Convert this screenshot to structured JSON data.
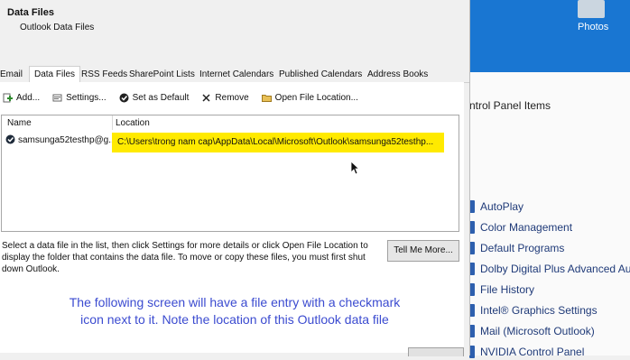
{
  "dialog": {
    "title": "Data Files",
    "subtitle": "Outlook Data Files",
    "tabs": [
      {
        "label": "Email",
        "active": false
      },
      {
        "label": "Data Files",
        "active": true
      },
      {
        "label": "RSS Feeds",
        "active": false
      },
      {
        "label": "SharePoint Lists",
        "active": false
      },
      {
        "label": "Internet Calendars",
        "active": false
      },
      {
        "label": "Published Calendars",
        "active": false
      },
      {
        "label": "Address Books",
        "active": false
      }
    ],
    "toolbar": {
      "add": "Add...",
      "settings": "Settings...",
      "set_default": "Set as Default",
      "remove": "Remove",
      "open_location": "Open File Location..."
    },
    "list": {
      "col_name": "Name",
      "col_location": "Location",
      "rows": [
        {
          "name": "samsunga52testhp@g...",
          "location": "C:\\Users\\trong nam cap\\AppData\\Local\\Microsoft\\Outlook\\samsunga52testhp..."
        }
      ]
    },
    "help_text": "Select a data file in the list, then click Settings for more details or click Open File Location to display the folder that contains the data file. To move or copy these files, you must first shut down Outlook.",
    "tell_me_more": "Tell Me More..."
  },
  "background": {
    "desktop_icon_label": "Photos",
    "control_panel_title": "ntrol Panel Items",
    "control_panel_items": [
      "AutoPlay",
      "Color Management",
      "Default Programs",
      "Dolby Digital Plus Advanced Audio",
      "File History",
      "Intel® Graphics Settings",
      "Mail (Microsoft Outlook)",
      "NVIDIA Control Panel"
    ]
  },
  "caption": {
    "line1": "The following screen will have a file entry with a checkmark",
    "line2": "icon next to it. Note the location of this Outlook data file"
  },
  "colors": {
    "highlight": "#ffea00",
    "caption": "#3b4bd0",
    "desktop_blue": "#1976d2"
  }
}
